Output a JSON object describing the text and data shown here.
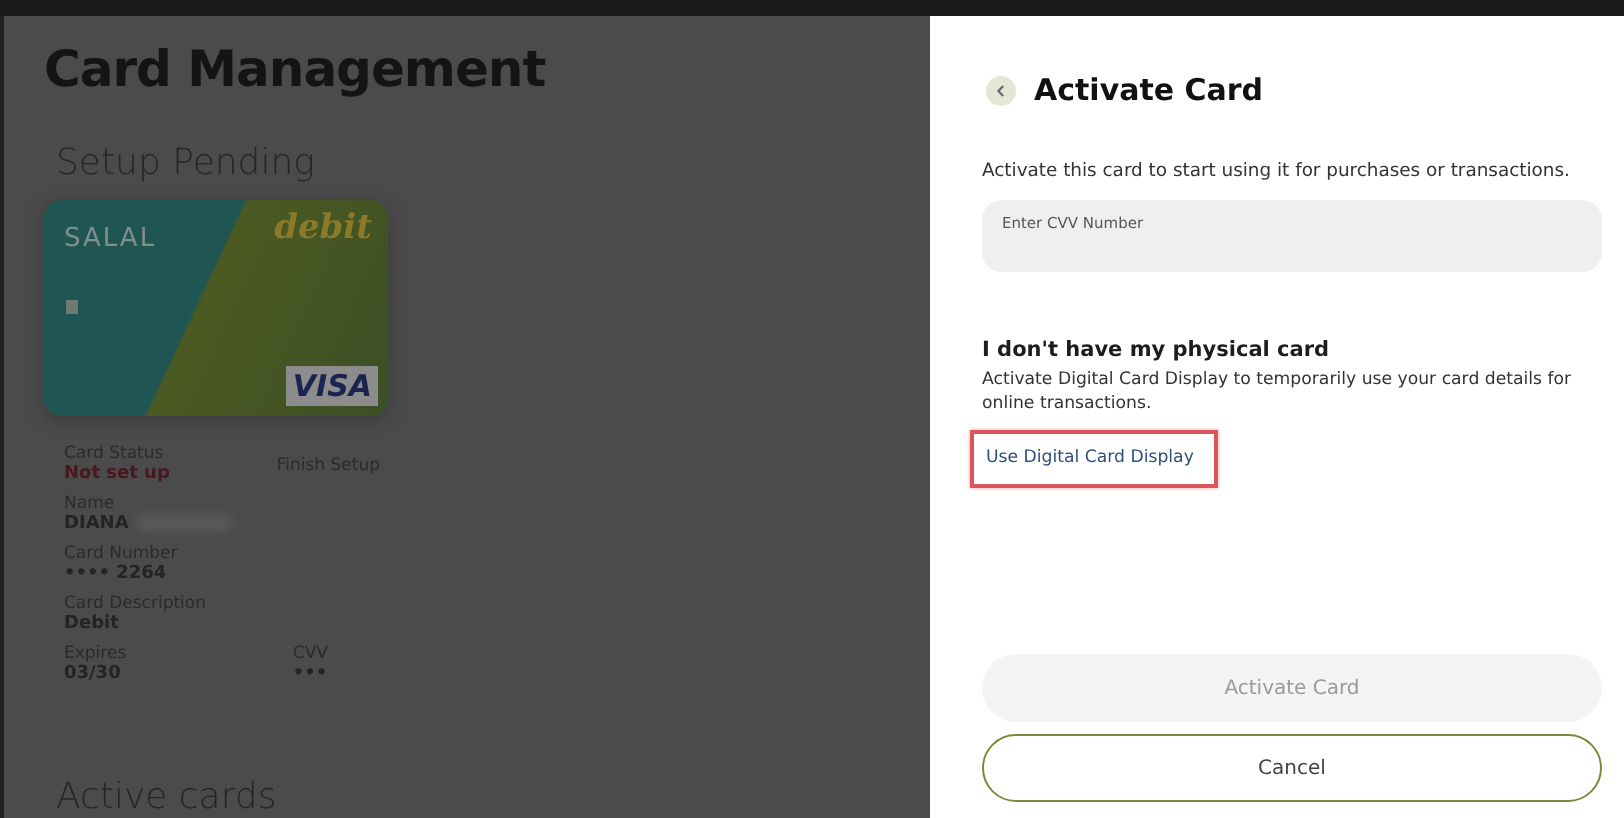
{
  "background_page": {
    "title": "Card Management",
    "section": "Setup Pending",
    "card": {
      "brand": "SALAL",
      "type": "debit",
      "network": "VISA"
    },
    "details": [
      {
        "label": "Card Status",
        "value": "Not set up",
        "kind": "status",
        "action": "Finish Setup"
      },
      {
        "label": "Name",
        "value": "DIANA",
        "kind": "redacted"
      },
      {
        "label": "Card Number",
        "value": "•••• 2264",
        "kind": "plain"
      },
      {
        "label": "Card Description",
        "value": "Debit",
        "kind": "plain"
      },
      {
        "label": "Expires",
        "value": "03/30",
        "kind": "pair",
        "label_2": "CVV",
        "value_2": "•••"
      }
    ],
    "next_section": "Active cards"
  },
  "panel": {
    "title": "Activate Card",
    "intro": "Activate this card to start using it for purchases or transactions.",
    "cvv_field": {
      "placeholder": "Enter CVV Number"
    },
    "heading": "I don't have my physical card",
    "text": "Activate Digital Card Display to temporarily use your card details for online transactions.",
    "link": {
      "label": "Use Digital Card Display",
      "highlighted": true
    },
    "buttons": [
      {
        "label": "Activate Card",
        "kind": "primary",
        "disabled": true
      },
      {
        "label": "Cancel",
        "kind": "outline",
        "disabled": false
      }
    ]
  }
}
